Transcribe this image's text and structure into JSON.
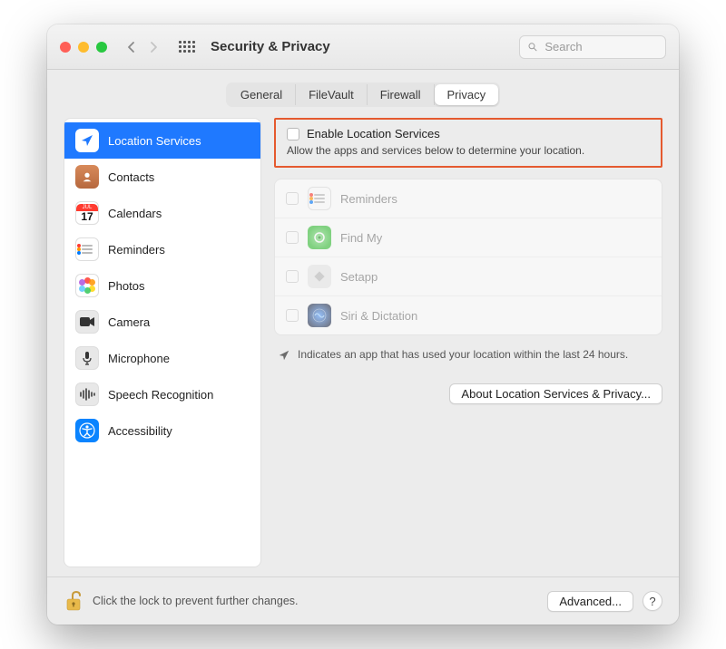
{
  "window": {
    "title": "Security & Privacy"
  },
  "search": {
    "placeholder": "Search",
    "value": ""
  },
  "tabs": [
    {
      "label": "General",
      "active": false
    },
    {
      "label": "FileVault",
      "active": false
    },
    {
      "label": "Firewall",
      "active": false
    },
    {
      "label": "Privacy",
      "active": true
    }
  ],
  "sidebar": {
    "items": [
      {
        "label": "Location Services",
        "selected": true,
        "icon": "location-arrow-icon"
      },
      {
        "label": "Contacts",
        "selected": false,
        "icon": "contacts-icon"
      },
      {
        "label": "Calendars",
        "selected": false,
        "icon": "calendar-icon",
        "cal_month": "JUL",
        "cal_day": "17"
      },
      {
        "label": "Reminders",
        "selected": false,
        "icon": "reminders-icon"
      },
      {
        "label": "Photos",
        "selected": false,
        "icon": "photos-icon"
      },
      {
        "label": "Camera",
        "selected": false,
        "icon": "camera-icon"
      },
      {
        "label": "Microphone",
        "selected": false,
        "icon": "microphone-icon"
      },
      {
        "label": "Speech Recognition",
        "selected": false,
        "icon": "waveform-icon"
      },
      {
        "label": "Accessibility",
        "selected": false,
        "icon": "accessibility-icon"
      }
    ]
  },
  "main": {
    "enable_label": "Enable Location Services",
    "enable_checked": false,
    "enable_desc": "Allow the apps and services below to determine your location.",
    "apps": [
      {
        "name": "Reminders",
        "checked": false,
        "icon": "reminders-app-icon"
      },
      {
        "name": "Find My",
        "checked": false,
        "icon": "findmy-app-icon"
      },
      {
        "name": "Setapp",
        "checked": false,
        "icon": "setapp-app-icon"
      },
      {
        "name": "Siri & Dictation",
        "checked": false,
        "icon": "siri-app-icon"
      }
    ],
    "indicator_text": "Indicates an app that has used your location within the last 24 hours.",
    "about_button": "About Location Services & Privacy..."
  },
  "footer": {
    "lock_text": "Click the lock to prevent further changes.",
    "advanced_button": "Advanced...",
    "help_label": "?"
  },
  "highlight_color": "#e55a2f"
}
